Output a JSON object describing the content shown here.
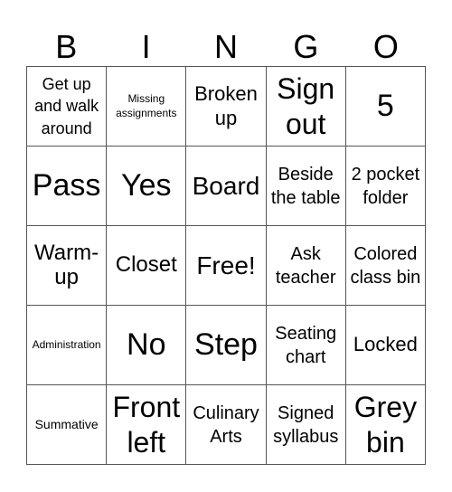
{
  "title_letters": [
    "B",
    "I",
    "N",
    "G",
    "O"
  ],
  "cells": [
    "Get up and walk around",
    "Missing assignments",
    "Broken up",
    "Sign out",
    "5",
    "Pass",
    "Yes",
    "Board",
    "Beside the table",
    "2 pocket folder",
    "Warm-up",
    "Closet",
    "Free!",
    "Ask teacher",
    "Colored class bin",
    "Administration",
    "No",
    "Step",
    "Seating chart",
    "Locked",
    "Summative",
    "Front left",
    "Culinary Arts",
    "Signed syllabus",
    "Grey bin"
  ]
}
